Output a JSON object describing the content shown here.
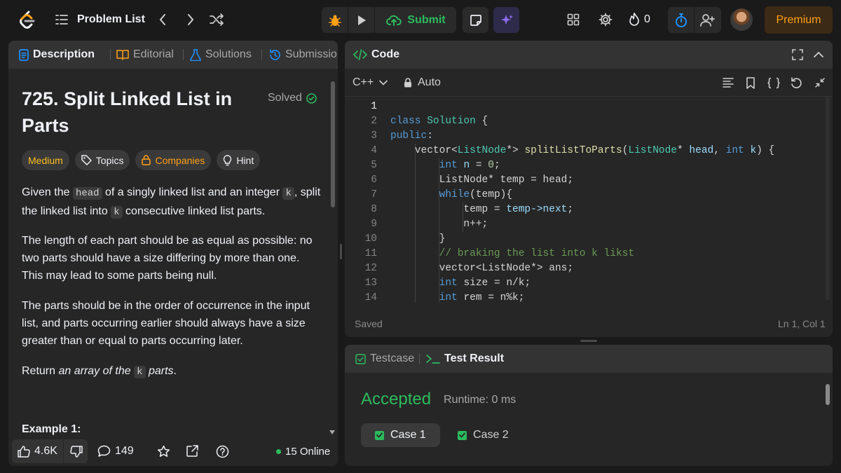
{
  "nav": {
    "problem_list_label": "Problem List",
    "submit_label": "Submit",
    "streak_count": "0",
    "premium_label": "Premium"
  },
  "description_tabs": [
    "Description",
    "Editorial",
    "Solutions",
    "Submissio"
  ],
  "problem": {
    "title": "725. Split Linked List in Parts",
    "status": "Solved",
    "difficulty": "Medium",
    "tags": [
      "Topics",
      "Companies",
      "Hint"
    ],
    "para1": {
      "a": "Given the ",
      "code1": "head",
      "b": " of a singly linked list and an integer ",
      "code2": "k",
      "c": ", split the linked list into ",
      "code3": "k",
      "d": " consecutive linked list parts."
    },
    "para2": "The length of each part should be as equal as possible: no two parts should have a size differing by more than one. This may lead to some parts being null.",
    "para3": "The parts should be in the order of occurrence in the input list, and parts occurring earlier should always have a size greater than or equal to parts occurring later.",
    "para4": {
      "a": "Return ",
      "em1": "an array of the ",
      "code": "k",
      "em2": " parts",
      "end": "."
    },
    "example_heading": "Example 1:"
  },
  "footer": {
    "likes": "4.6K",
    "comments": "149",
    "online": "15 Online"
  },
  "code_panel": {
    "title": "Code",
    "language": "C++",
    "mode": "Auto",
    "saved": "Saved",
    "cursor": "Ln 1, Col 1"
  },
  "code_lines": [
    {
      "n": "1",
      "tokens": []
    },
    {
      "n": "2",
      "tokens": [
        [
          "kw",
          "class "
        ],
        [
          "ty",
          "Solution"
        ],
        [
          "txt",
          " {"
        ]
      ]
    },
    {
      "n": "3",
      "tokens": [
        [
          "kw",
          "public"
        ],
        [
          "txt",
          ":"
        ]
      ]
    },
    {
      "n": "4",
      "tokens": [
        [
          "txt",
          "    vector<"
        ],
        [
          "ty",
          "ListNode"
        ],
        [
          "txt",
          "*> "
        ],
        [
          "fn",
          "splitListToParts"
        ],
        [
          "txt",
          "("
        ],
        [
          "ty",
          "ListNode"
        ],
        [
          "txt",
          "* "
        ],
        [
          "var",
          "head"
        ],
        [
          "txt",
          ", "
        ],
        [
          "kw",
          "int "
        ],
        [
          "var",
          "k"
        ],
        [
          "txt",
          ") {"
        ]
      ]
    },
    {
      "n": "5",
      "tokens": [
        [
          "txt",
          "        "
        ],
        [
          "kw",
          "int "
        ],
        [
          "var",
          "n"
        ],
        [
          "txt",
          " = "
        ],
        [
          "num",
          "0"
        ],
        [
          "txt",
          ";"
        ]
      ]
    },
    {
      "n": "6",
      "tokens": [
        [
          "txt",
          "        ListNode* temp = head;"
        ]
      ]
    },
    {
      "n": "7",
      "tokens": [
        [
          "txt",
          "        "
        ],
        [
          "kw",
          "while"
        ],
        [
          "txt",
          "(temp){"
        ]
      ]
    },
    {
      "n": "8",
      "tokens": [
        [
          "txt",
          "            temp = "
        ],
        [
          "var",
          "temp->next"
        ],
        [
          "txt",
          ";"
        ]
      ]
    },
    {
      "n": "9",
      "tokens": [
        [
          "txt",
          "            n++;"
        ]
      ]
    },
    {
      "n": "10",
      "tokens": [
        [
          "txt",
          "        }"
        ]
      ]
    },
    {
      "n": "11",
      "tokens": [
        [
          "cmt",
          "        // braking the list into k likst"
        ]
      ]
    },
    {
      "n": "12",
      "tokens": [
        [
          "txt",
          "        vector<ListNode*> ans;"
        ]
      ]
    },
    {
      "n": "13",
      "tokens": [
        [
          "txt",
          "        "
        ],
        [
          "kw",
          "int "
        ],
        [
          "txt",
          "size = n/k;"
        ]
      ]
    },
    {
      "n": "14",
      "tokens": [
        [
          "txt",
          "        "
        ],
        [
          "kw",
          "int "
        ],
        [
          "txt",
          "rem = n%k;"
        ]
      ]
    }
  ],
  "result_panel": {
    "tabs": [
      "Testcase",
      "Test Result"
    ],
    "verdict": "Accepted",
    "runtime": "Runtime: 0 ms",
    "cases": [
      "Case 1",
      "Case 2"
    ]
  },
  "colors": {
    "accent_green": "#2cbb5d",
    "premium_orange": "#ffa116",
    "medium_yellow": "#ffc01e",
    "ai_purple": "#8e6cef"
  }
}
